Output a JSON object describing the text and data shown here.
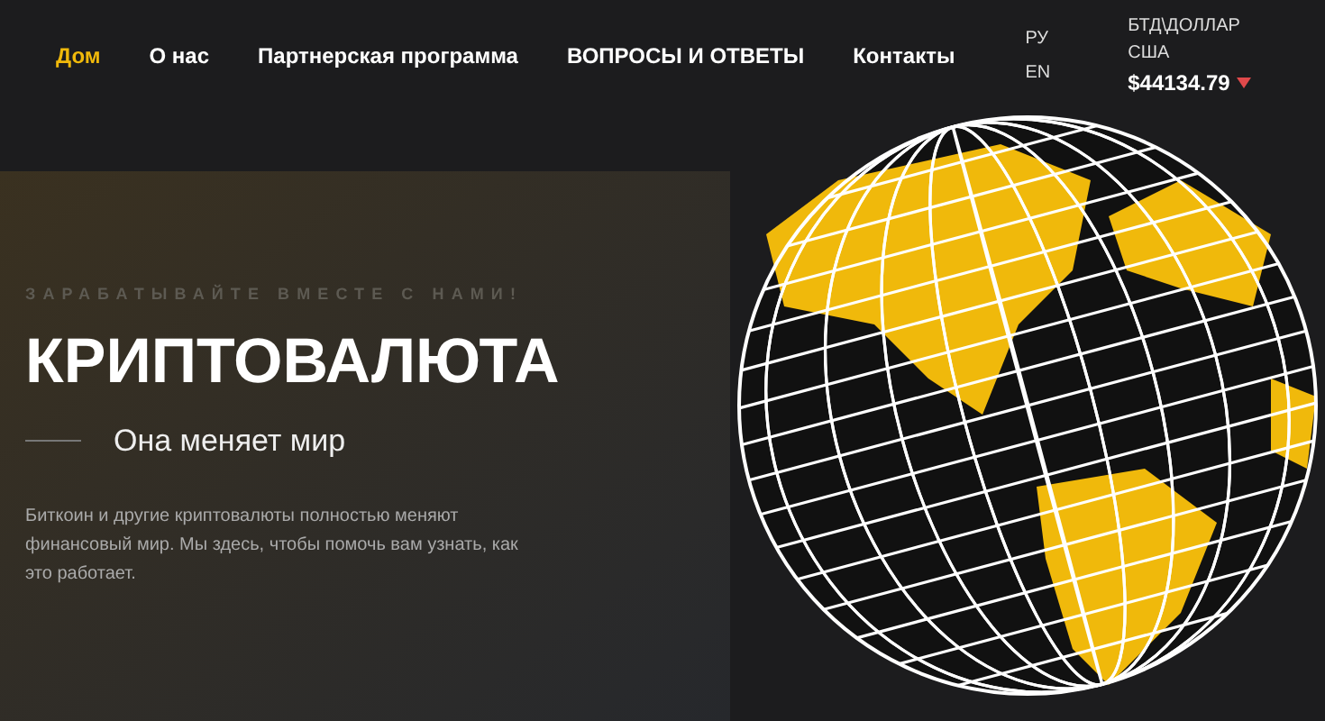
{
  "nav": [
    {
      "label": "Дом",
      "selected": true
    },
    {
      "label": "О нас",
      "selected": false
    },
    {
      "label": "Партнерская программа",
      "selected": false
    },
    {
      "label": "ВОПРОСЫ И ОТВЕТЫ",
      "selected": false
    },
    {
      "label": "Контакты",
      "selected": false
    }
  ],
  "languages": [
    "РУ",
    "EN"
  ],
  "ticker": {
    "label": "БТД\\ДОЛЛАР США",
    "price": "$44134.79",
    "falling": true
  },
  "hero": {
    "eyebrow": "ЗАРАБАТЫВАЙТЕ ВМЕСТЕ С НАМИ!",
    "title": "КРИПТОВАЛЮТА",
    "subtitle": "Она меняет мир",
    "text": "Биткоин и другие криптовалюты полностью меняют финансовый мир. Мы здесь, чтобы помочь вам узнать, как это работает."
  }
}
